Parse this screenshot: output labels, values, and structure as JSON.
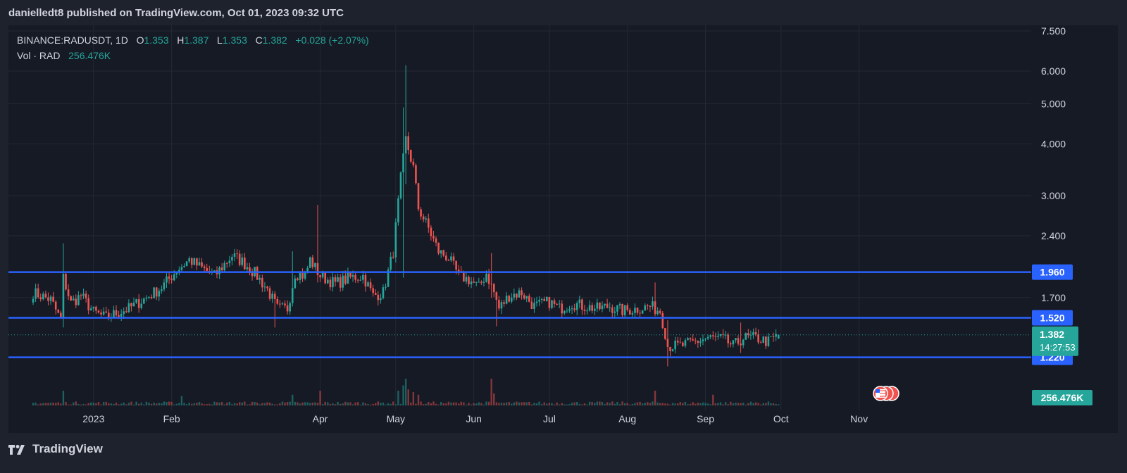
{
  "header": {
    "published_line": "danielledt8 published on TradingView.com, Oct 01, 2023 09:32 UTC"
  },
  "legend": {
    "symbol": "BINANCE:RADUSDT, 1D",
    "o_label": "O",
    "o": "1.353",
    "h_label": "H",
    "h": "1.387",
    "l_label": "L",
    "l": "1.353",
    "c_label": "C",
    "c": "1.382",
    "change": "+0.028 (+2.07%)",
    "vol_label": "Vol · RAD",
    "vol_value": "256.476K"
  },
  "footer": {
    "brand": "TradingView"
  },
  "colors": {
    "up": "#26a69a",
    "down": "#ef5350",
    "level_line": "#2962ff",
    "background": "#161a25",
    "grid": "#242833"
  },
  "chart_data": {
    "type": "candlestick",
    "symbol": "BINANCE:RADUSDT",
    "interval": "1D",
    "y_scale": "log",
    "ylim": [
      1.06,
      7.5
    ],
    "x_range": [
      "2022-12-01",
      "2023-11-18"
    ],
    "y_ticks": [
      "7.500",
      "6.000",
      "5.000",
      "4.000",
      "3.000",
      "2.400",
      "1.700"
    ],
    "x_ticks": [
      {
        "date": "2023-01-01",
        "label": "2023"
      },
      {
        "date": "2023-02-01",
        "label": "Feb"
      },
      {
        "date": "2023-04-01",
        "label": "Apr"
      },
      {
        "date": "2023-05-01",
        "label": "May"
      },
      {
        "date": "2023-06-01",
        "label": "Jun"
      },
      {
        "date": "2023-07-01",
        "label": "Jul"
      },
      {
        "date": "2023-08-01",
        "label": "Aug"
      },
      {
        "date": "2023-09-01",
        "label": "Sep"
      },
      {
        "date": "2023-10-01",
        "label": "Oct"
      },
      {
        "date": "2023-11-01",
        "label": "Nov"
      }
    ],
    "horizontal_levels": [
      {
        "value": 1.96,
        "label": "1.960"
      },
      {
        "value": 1.52,
        "label": "1.520"
      },
      {
        "value": 1.22,
        "label": "1.220"
      }
    ],
    "last_price": {
      "value": 1.382,
      "label": "1.382",
      "countdown": "14:27:53"
    },
    "volume_label": "256.476K",
    "anchors": [
      [
        "2022-12-08",
        1.75
      ],
      [
        "2022-12-15",
        1.68
      ],
      [
        "2022-12-19",
        1.5
      ],
      [
        "2022-12-20",
        1.9
      ],
      [
        "2022-12-23",
        1.65
      ],
      [
        "2022-12-27",
        1.72
      ],
      [
        "2023-01-01",
        1.57
      ],
      [
        "2023-01-06",
        1.52
      ],
      [
        "2023-01-10",
        1.56
      ],
      [
        "2023-01-15",
        1.6
      ],
      [
        "2023-01-22",
        1.7
      ],
      [
        "2023-01-28",
        1.8
      ],
      [
        "2023-02-03",
        1.98
      ],
      [
        "2023-02-08",
        2.1
      ],
      [
        "2023-02-12",
        2.02
      ],
      [
        "2023-02-18",
        1.92
      ],
      [
        "2023-02-25",
        2.15
      ],
      [
        "2023-03-01",
        2.08
      ],
      [
        "2023-03-06",
        1.95
      ],
      [
        "2023-03-11",
        1.78
      ],
      [
        "2023-03-15",
        1.6
      ],
      [
        "2023-03-19",
        1.6
      ],
      [
        "2023-03-22",
        1.95
      ],
      [
        "2023-03-26",
        1.92
      ],
      [
        "2023-03-28",
        2.1
      ],
      [
        "2023-04-01",
        1.92
      ],
      [
        "2023-04-07",
        1.84
      ],
      [
        "2023-04-13",
        1.9
      ],
      [
        "2023-04-18",
        1.92
      ],
      [
        "2023-04-22",
        1.72
      ],
      [
        "2023-04-26",
        1.75
      ],
      [
        "2023-04-30",
        2.2
      ],
      [
        "2023-05-03",
        3.3
      ],
      [
        "2023-05-05",
        4.1
      ],
      [
        "2023-05-08",
        3.5
      ],
      [
        "2023-05-10",
        2.8
      ],
      [
        "2023-05-14",
        2.5
      ],
      [
        "2023-05-18",
        2.2
      ],
      [
        "2023-05-22",
        2.12
      ],
      [
        "2023-05-26",
        1.92
      ],
      [
        "2023-05-30",
        1.88
      ],
      [
        "2023-06-03",
        1.8
      ],
      [
        "2023-06-06",
        1.95
      ],
      [
        "2023-06-09",
        1.75
      ],
      [
        "2023-06-11",
        1.6
      ],
      [
        "2023-06-15",
        1.72
      ],
      [
        "2023-06-20",
        1.75
      ],
      [
        "2023-06-25",
        1.62
      ],
      [
        "2023-07-01",
        1.66
      ],
      [
        "2023-07-05",
        1.6
      ],
      [
        "2023-07-10",
        1.65
      ],
      [
        "2023-07-15",
        1.62
      ],
      [
        "2023-07-20",
        1.6
      ],
      [
        "2023-07-25",
        1.62
      ],
      [
        "2023-07-30",
        1.58
      ],
      [
        "2023-08-05",
        1.6
      ],
      [
        "2023-08-10",
        1.62
      ],
      [
        "2023-08-14",
        1.58
      ],
      [
        "2023-08-16",
        1.4
      ],
      [
        "2023-08-17",
        1.3
      ],
      [
        "2023-08-22",
        1.3
      ],
      [
        "2023-08-28",
        1.33
      ],
      [
        "2023-09-02",
        1.36
      ],
      [
        "2023-09-08",
        1.35
      ],
      [
        "2023-09-12",
        1.3
      ],
      [
        "2023-09-16",
        1.36
      ],
      [
        "2023-09-21",
        1.36
      ],
      [
        "2023-09-26",
        1.33
      ],
      [
        "2023-09-30",
        1.382
      ]
    ],
    "spikes": [
      [
        "2022-12-20",
        2.3,
        1.44
      ],
      [
        "2023-03-14",
        1.62,
        1.44
      ],
      [
        "2023-03-21",
        2.2,
        1.7
      ],
      [
        "2023-03-31",
        2.85,
        1.85
      ],
      [
        "2023-05-04",
        4.9,
        1.9
      ],
      [
        "2023-05-05",
        6.2,
        3.2
      ],
      [
        "2023-06-08",
        2.18,
        1.7
      ],
      [
        "2023-06-10",
        1.75,
        1.45
      ],
      [
        "2023-08-12",
        1.85,
        1.55
      ],
      [
        "2023-08-17",
        1.5,
        1.16
      ],
      [
        "2023-09-15",
        1.48,
        1.25
      ]
    ],
    "volume_spikes": [
      [
        "2022-12-20",
        0.55
      ],
      [
        "2023-02-05",
        0.35
      ],
      [
        "2023-03-21",
        0.4
      ],
      [
        "2023-04-01",
        0.55
      ],
      [
        "2023-05-02",
        0.55
      ],
      [
        "2023-05-04",
        0.75
      ],
      [
        "2023-05-05",
        1.0
      ],
      [
        "2023-05-06",
        0.6
      ],
      [
        "2023-05-08",
        0.5
      ],
      [
        "2023-05-10",
        0.4
      ],
      [
        "2023-06-08",
        1.0
      ],
      [
        "2023-06-09",
        0.45
      ],
      [
        "2023-08-12",
        0.55
      ],
      [
        "2023-09-04",
        0.4
      ]
    ]
  }
}
